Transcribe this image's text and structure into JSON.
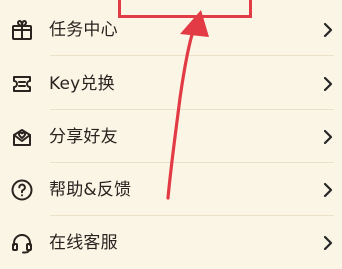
{
  "menu": {
    "items": [
      {
        "label": "任务中心",
        "icon": "gift-icon"
      },
      {
        "label": "Key兑换",
        "icon": "ticket-icon"
      },
      {
        "label": "分享好友",
        "icon": "share-icon"
      },
      {
        "label": "帮助&反馈",
        "icon": "help-icon"
      },
      {
        "label": "在线客服",
        "icon": "headset-icon"
      }
    ]
  },
  "annotation": {
    "highlight_color": "#e33b45"
  }
}
